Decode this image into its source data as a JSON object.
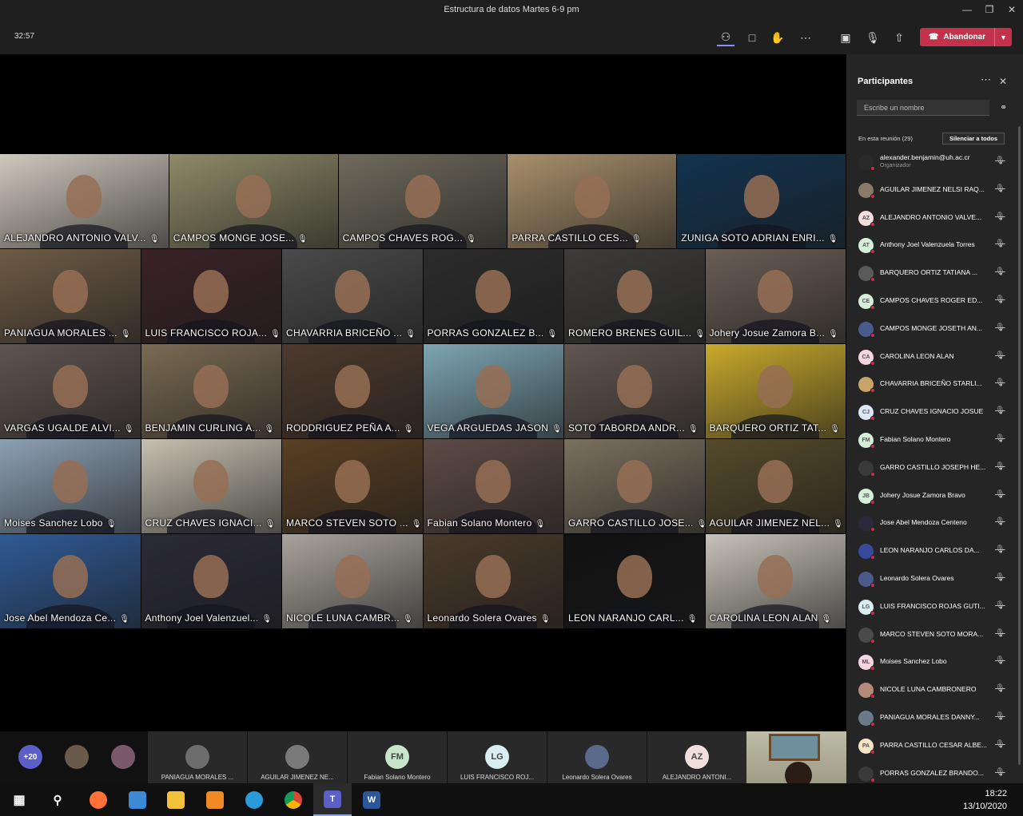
{
  "window": {
    "title": "Estructura de datos Martes 6-9 pm"
  },
  "meeting": {
    "timer": "32:57",
    "leave_label": "Abandonar"
  },
  "grid": {
    "rows": [
      [
        {
          "name": "ALEJANDRO ANTONIO VALV...",
          "bg": "#cfc8bd"
        },
        {
          "name": "CAMPOS MONGE JOSE...",
          "bg": "#8e8a67"
        },
        {
          "name": "CAMPOS CHAVES ROG...",
          "bg": "#6f6a5c"
        },
        {
          "name": "PARRA CASTILLO CES...",
          "bg": "#a88f6a"
        },
        {
          "name": "ZUNIGA SOTO ADRIAN ENRI...",
          "bg": "#12334f"
        }
      ],
      [
        {
          "name": "PANIAGUA MORALES ...",
          "bg": "#6e5b45"
        },
        {
          "name": "LUIS FRANCISCO ROJA...",
          "bg": "#3a2227"
        },
        {
          "name": "CHAVARRIA BRICEÑO ...",
          "bg": "#4a4a4a"
        },
        {
          "name": "PORRAS GONZALEZ B...",
          "bg": "#2c2c2c"
        },
        {
          "name": "ROMERO BRENES GUIL...",
          "bg": "#3d3c3a"
        },
        {
          "name": "Johery Josue Zamora B...",
          "bg": "#6a5e55"
        }
      ],
      [
        {
          "name": "VARGAS UGALDE ALVI...",
          "bg": "#5f5450"
        },
        {
          "name": "BENJAMIN CURLING A...",
          "bg": "#7a6a52"
        },
        {
          "name": "RODDRIGUEZ PEÑA A...",
          "bg": "#4d3a2d"
        },
        {
          "name": "VEGA ARGUEDAS JASON",
          "bg": "#7da5b3"
        },
        {
          "name": "SOTO TABORDA ANDR...",
          "bg": "#62564f"
        },
        {
          "name": "BARQUERO ORTIZ TAT...",
          "bg": "#c9a92c"
        }
      ],
      [
        {
          "name": "Moises Sanchez Lobo",
          "bg": "#8ca0b4"
        },
        {
          "name": "CRUZ CHAVES IGNACI...",
          "bg": "#c6c0b0"
        },
        {
          "name": "MARCO STEVEN SOTO ...",
          "bg": "#5a3f22"
        },
        {
          "name": "Fabian Solano Montero",
          "bg": "#5e4b45"
        },
        {
          "name": "GARRO CASTILLO JOSE...",
          "bg": "#7a705e"
        },
        {
          "name": "AGUILAR JIMENEZ NEL...",
          "bg": "#554a2a"
        }
      ],
      [
        {
          "name": "Jose Abel Mendoza Ce...",
          "bg": "#2f5a96"
        },
        {
          "name": "Anthony Joel Valenzuel...",
          "bg": "#2b2a38"
        },
        {
          "name": "NICOLE LUNA CAMBR...",
          "bg": "#a9a39c"
        },
        {
          "name": "Leonardo  Solera Ovares",
          "bg": "#4a3a2a"
        },
        {
          "name": "LEON NARANJO CARL...",
          "bg": "#111111"
        },
        {
          "name": "CAROLINA LEON ALAN",
          "bg": "#c7c2b8"
        }
      ]
    ]
  },
  "strip": {
    "overflow_label": "+20",
    "thumbs": [
      {
        "name": "PANIAGUA MORALES ...",
        "initials": "",
        "color": "#6d6d6d"
      },
      {
        "name": "AGUILAR JIMENEZ NE...",
        "initials": "",
        "color": "#7a7a7a"
      },
      {
        "name": "Fabian Solano Montero",
        "initials": "FM",
        "color": "#c8e6c9"
      },
      {
        "name": "LUIS FRANCISCO ROJ...",
        "initials": "LG",
        "color": "#d8eef0"
      },
      {
        "name": "Leonardo Solera Ovares",
        "initials": "",
        "color": "#5a6a8a"
      },
      {
        "name": "ALEJANDRO ANTONI...",
        "initials": "AZ",
        "color": "#f3dede"
      }
    ]
  },
  "panel": {
    "title": "Participantes",
    "search_placeholder": "Escribe un nombre",
    "in_meeting": "En esta reunión (29)",
    "mute_all": "Silenciar a todos",
    "participants": [
      {
        "name": "alexander.benjamin@uh.ac.cr",
        "role": "Organizador",
        "initials": "",
        "color": "#2a2a2a"
      },
      {
        "name": "AGUILAR JIMENEZ NELSI RAQ...",
        "initials": "",
        "color": "#8a7a6a"
      },
      {
        "name": "ALEJANDRO ANTONIO VALVE...",
        "initials": "AZ",
        "color": "#f3dede"
      },
      {
        "name": "Anthony Joel Valenzuela Torres",
        "initials": "AT",
        "color": "#d6efd8"
      },
      {
        "name": "BARQUERO ORTIZ TATIANA ...",
        "initials": "",
        "color": "#5a5a5a"
      },
      {
        "name": "CAMPOS CHAVES ROGER ED...",
        "initials": "CE",
        "color": "#d6efd8"
      },
      {
        "name": "CAMPOS MONGE JOSETH AN...",
        "initials": "",
        "color": "#4a5a8a"
      },
      {
        "name": "CAROLINA LEON ALAN",
        "initials": "CA",
        "color": "#f6d5e3"
      },
      {
        "name": "CHAVARRIA BRICEÑO STARLI...",
        "initials": "",
        "color": "#c9a46a"
      },
      {
        "name": "CRUZ CHAVES IGNACIO JOSUE",
        "initials": "CJ",
        "color": "#dbe6f7"
      },
      {
        "name": "Fabian Solano Montero",
        "initials": "FM",
        "color": "#d6efd8"
      },
      {
        "name": "GARRO CASTILLO JOSEPH HE...",
        "initials": "",
        "color": "#3a3a3a"
      },
      {
        "name": "Johery Josue Zamora Bravo",
        "initials": "JB",
        "color": "#d6efd8"
      },
      {
        "name": "Jose Abel Mendoza Centeno",
        "initials": "",
        "color": "#2a2a3a"
      },
      {
        "name": "LEON NARANJO CARLOS DA...",
        "initials": "",
        "color": "#3a4a9a"
      },
      {
        "name": "Leonardo Solera Ovares",
        "initials": "",
        "color": "#4a5a8a"
      },
      {
        "name": "LUIS FRANCISCO ROJAS GUTI...",
        "initials": "LG",
        "color": "#d8eef0"
      },
      {
        "name": "MARCO STEVEN SOTO MORA...",
        "initials": "",
        "color": "#4a4a4a"
      },
      {
        "name": "Moises Sanchez Lobo",
        "initials": "ML",
        "color": "#f6d5e3"
      },
      {
        "name": "NICOLE LUNA CAMBRONERO",
        "initials": "",
        "color": "#b48a7a"
      },
      {
        "name": "PANIAGUA MORALES DANNY...",
        "initials": "",
        "color": "#6a7a8a"
      },
      {
        "name": "PARRA CASTILLO CESAR ALBE...",
        "initials": "PA",
        "color": "#f7e4c8"
      },
      {
        "name": "PORRAS GONZALEZ BRANDO...",
        "initials": "",
        "color": "#3a3a3a"
      }
    ]
  },
  "taskbar": {
    "time": "18:22",
    "date": "13/10/2020"
  }
}
